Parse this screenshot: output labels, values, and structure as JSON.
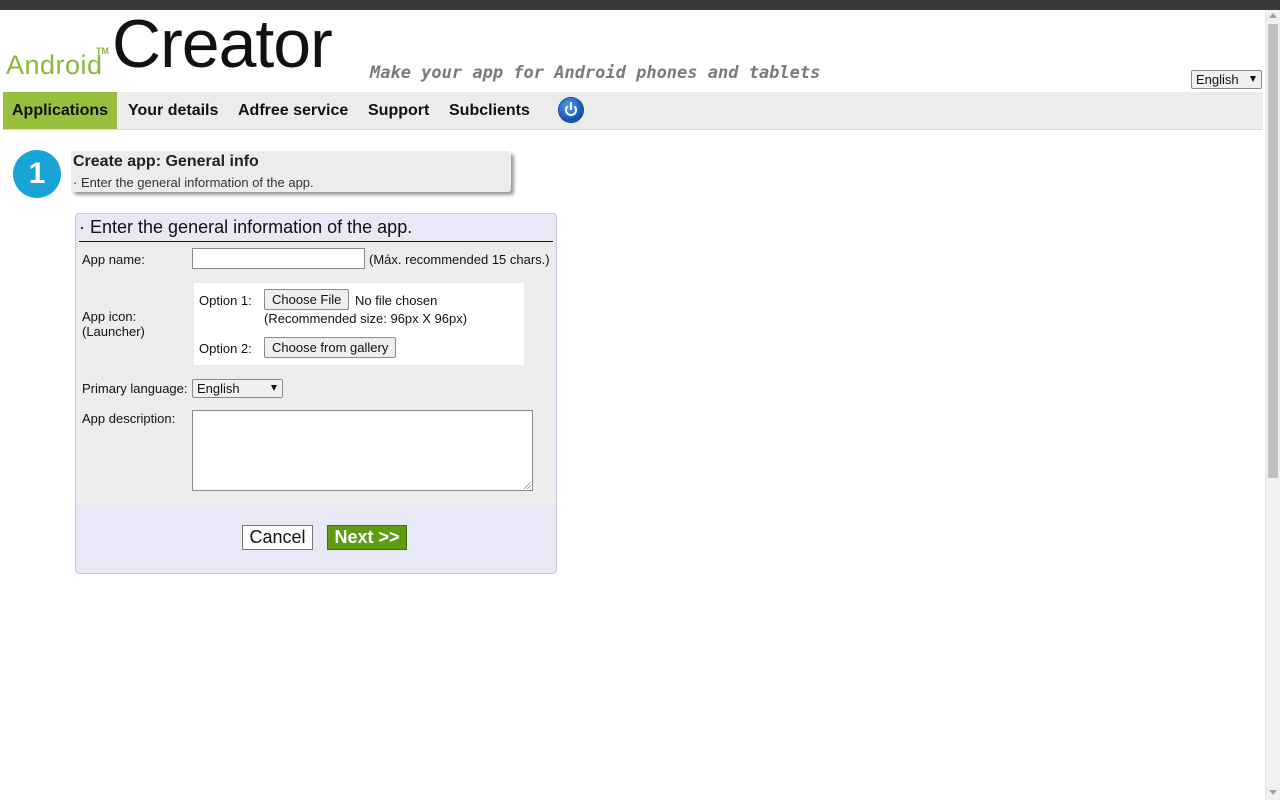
{
  "header": {
    "logo_android": "Android",
    "logo_tm": "TM",
    "logo_creator": "Creator",
    "tagline": "Make your app for Android phones and tablets",
    "language_selected": "English"
  },
  "nav": {
    "items": [
      {
        "label": "Applications",
        "active": true
      },
      {
        "label": "Your details",
        "active": false
      },
      {
        "label": "Adfree service",
        "active": false
      },
      {
        "label": "Support",
        "active": false
      },
      {
        "label": "Subclients",
        "active": false
      }
    ],
    "logout_icon": "power-icon"
  },
  "step": {
    "number": "1",
    "title": "Create app: General info",
    "subtitle": "· Enter the general information of the app."
  },
  "form": {
    "heading": "· Enter the general information of the app.",
    "app_name_label": "App name:",
    "app_name_value": "",
    "app_name_hint": "(Máx. recommended 15 chars.)",
    "app_icon_label": "App icon:",
    "app_icon_sublabel": "(Launcher)",
    "option1_label": "Option 1:",
    "choose_file_button": "Choose File",
    "no_file_text": "No file chosen",
    "recommended_size": "(Recommended size: 96px X 96px)",
    "option2_label": "Option 2:",
    "gallery_button": "Choose from gallery",
    "primary_language_label": "Primary language:",
    "primary_language_value": "English",
    "description_label": "App description:",
    "description_value": "",
    "cancel_button": "Cancel",
    "next_button": "Next >>"
  },
  "colors": {
    "brand_green": "#8cb63c",
    "nav_active": "#97bf3d",
    "step_blue": "#1aa3d6",
    "next_green": "#5e9c14",
    "panel_bg": "#e8e8f6"
  }
}
